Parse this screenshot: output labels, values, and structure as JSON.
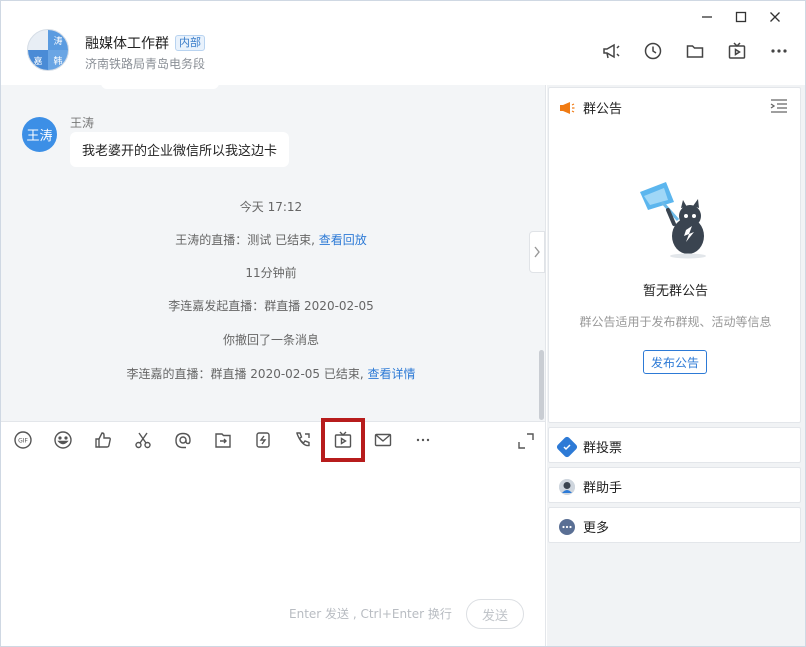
{
  "window": {
    "controls": {
      "minimize": "—",
      "maximize": "☐",
      "close": "✕"
    }
  },
  "header": {
    "group_name": "融媒体工作群",
    "badge": "内部",
    "subtitle": "济南铁路局青岛电务段",
    "avatar_chars": [
      "涛",
      "嘉",
      "韩"
    ],
    "tools": [
      "announcement-icon",
      "history-icon",
      "folder-icon",
      "live-icon",
      "more-icon"
    ]
  },
  "chat": {
    "sender_avatar": "王涛",
    "sender_name": "王涛",
    "message": "我老婆开的企业微信所以我这边卡",
    "system_lines": [
      {
        "text": "今天 17:12",
        "link": ""
      },
      {
        "text": "王涛的直播：测试 已结束, ",
        "link": "查看回放"
      },
      {
        "text": "11分钟前",
        "link": ""
      },
      {
        "text": "李连嘉发起直播：群直播 2020-02-05",
        "link": ""
      },
      {
        "text": "你撤回了一条消息",
        "link": ""
      },
      {
        "text": "李连嘉的直播：群直播 2020-02-05 已结束, ",
        "link": "查看详情"
      }
    ]
  },
  "input": {
    "toolbar": [
      "gif-icon",
      "emoji-icon",
      "thumbs-up-icon",
      "scissors-icon",
      "at-icon",
      "share-screen-icon",
      "red-packet-icon",
      "call-icon",
      "live-icon",
      "mail-icon",
      "more-icon"
    ],
    "hint": "Enter 发送 , Ctrl+Enter 换行",
    "send_label": "发送"
  },
  "side": {
    "notice_title": "群公告",
    "empty_title": "暂无群公告",
    "empty_desc": "群公告适用于发布群规、活动等信息",
    "publish_label": "发布公告",
    "vote_label": "群投票",
    "assistant_label": "群助手",
    "more_label": "更多"
  },
  "colors": {
    "accent": "#2d7ad6",
    "highlight": "#b71c1c",
    "avatar_blue": "#3c8fe6"
  }
}
